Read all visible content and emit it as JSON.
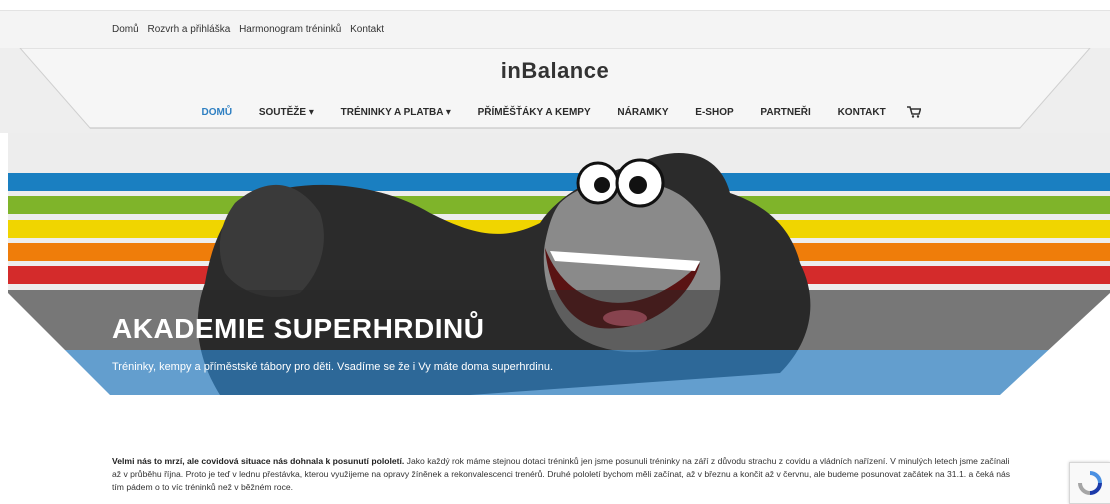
{
  "topbar": {
    "links": [
      "Domů",
      "Rozvrh a přihláška",
      "Harmonogram tréninků",
      "Kontakt"
    ]
  },
  "header": {
    "brand": "inBalance"
  },
  "nav": {
    "items": [
      {
        "label": "DOMŮ",
        "active": true
      },
      {
        "label": "SOUTĚŽE ▾",
        "active": false
      },
      {
        "label": "TRÉNINKY A PLATBA ▾",
        "active": false
      },
      {
        "label": "PŘÍMĚŠŤÁKY A KEMPY",
        "active": false
      },
      {
        "label": "NÁRAMKY",
        "active": false
      },
      {
        "label": "E-SHOP",
        "active": false
      },
      {
        "label": "PARTNEŘI",
        "active": false
      },
      {
        "label": "KONTAKT",
        "active": false
      }
    ],
    "cart_icon": "cart-icon"
  },
  "hero": {
    "title": "AKADEMIE SUPERHRDINŮ",
    "subtitle": "Tréninky, kempy a příměstské tábory pro děti. Vsadíme se že i Vy máte doma superhrdinu.",
    "stripe_colors": [
      "#1a7fc1",
      "#7fb42a",
      "#f0d500",
      "#ef7d0a",
      "#d42b2b"
    ],
    "accent": "#2e7fc2"
  },
  "content": {
    "bold_lead": "Velmi nás to mrzí, ale covidová situace nás dohnala k posunutí pololetí.",
    "text": " Jako každý rok máme stejnou dotaci tréninků jen jsme posunuli tréninky na září z důvodu strachu z covidu a vládních nařízení. V minulých letech jsme začínali až v průběhu října. Proto je teď v lednu přestávka, kterou využijeme na opravy žíněnek a rekonvalescenci trenérů. Druhé pololetí bychom měli začínat, až v březnu a končit až v červnu, ale budeme posunovat začátek na 31.1. a čeká nás tím pádem o to víc tréninků než v běžném roce."
  },
  "widgets": {
    "recaptcha_icon": "recaptcha-icon"
  }
}
